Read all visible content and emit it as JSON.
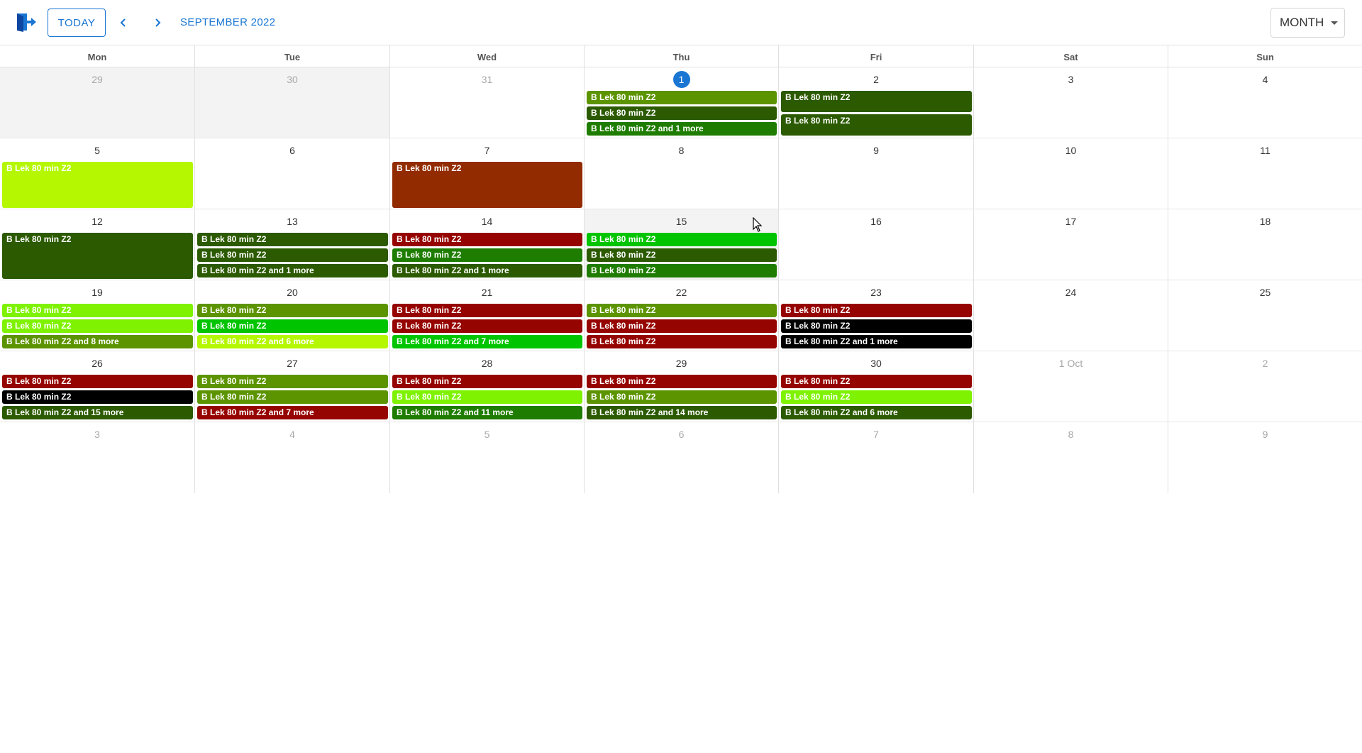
{
  "toolbar": {
    "exit_icon": "exit-to-app-icon",
    "today_label": "TODAY",
    "prev_icon": "chevron-left-icon",
    "next_icon": "chevron-right-icon",
    "month_title": "SEPTEMBER 2022",
    "view_label": "MONTH",
    "accent_color": "#1976d2"
  },
  "weekdays": [
    "Mon",
    "Tue",
    "Wed",
    "Thu",
    "Fri",
    "Sat",
    "Sun"
  ],
  "weeks": [
    [
      {
        "label": "29",
        "outside": true,
        "shaded": true,
        "events": []
      },
      {
        "label": "30",
        "outside": true,
        "shaded": true,
        "events": []
      },
      {
        "label": "31",
        "outside": true,
        "events": []
      },
      {
        "label": "1",
        "today": true,
        "events": [
          {
            "text": "B Lek 80 min Z2",
            "color": "#5c9400"
          },
          {
            "text": "B Lek 80 min Z2",
            "color": "#2b5a00"
          },
          {
            "text": "B Lek 80 min Z2 and 1 more",
            "color": "#1e7d00"
          }
        ]
      },
      {
        "label": "2",
        "events": [
          {
            "text": "B Lek 80 min Z2",
            "color": "#2b5a00",
            "size": "tall"
          },
          {
            "text": "B Lek 80 min Z2",
            "color": "#2b5a00",
            "size": "tall"
          }
        ]
      },
      {
        "label": "3",
        "events": []
      },
      {
        "label": "4",
        "events": []
      }
    ],
    [
      {
        "label": "5",
        "events": [
          {
            "text": "B Lek 80 min Z2",
            "color": "#b4f700",
            "size": "big"
          }
        ]
      },
      {
        "label": "6",
        "events": []
      },
      {
        "label": "7",
        "events": [
          {
            "text": "B Lek 80 min Z2",
            "color": "#922b00",
            "size": "big"
          }
        ]
      },
      {
        "label": "8",
        "events": []
      },
      {
        "label": "9",
        "events": []
      },
      {
        "label": "10",
        "events": []
      },
      {
        "label": "11",
        "events": []
      }
    ],
    [
      {
        "label": "12",
        "events": [
          {
            "text": "B Lek 80 min Z2",
            "color": "#2b5a00",
            "size": "big"
          }
        ]
      },
      {
        "label": "13",
        "events": [
          {
            "text": "B Lek 80 min Z2",
            "color": "#2b5a00"
          },
          {
            "text": "B Lek 80 min Z2",
            "color": "#2b5a00"
          },
          {
            "text": "B Lek 80 min Z2 and 1 more",
            "color": "#2b5a00"
          }
        ]
      },
      {
        "label": "14",
        "events": [
          {
            "text": "B Lek 80 min Z2",
            "color": "#950400"
          },
          {
            "text": "B Lek 80 min Z2",
            "color": "#1e7d00"
          },
          {
            "text": "B Lek 80 min Z2 and 1 more",
            "color": "#2b5a00"
          }
        ]
      },
      {
        "label": "15",
        "shaded": true,
        "events": [
          {
            "text": "B Lek 80 min Z2",
            "color": "#00c400"
          },
          {
            "text": "B Lek 80 min Z2",
            "color": "#2b5a00"
          },
          {
            "text": "B Lek 80 min Z2",
            "color": "#1e7d00"
          }
        ]
      },
      {
        "label": "16",
        "events": []
      },
      {
        "label": "17",
        "events": []
      },
      {
        "label": "18",
        "events": []
      }
    ],
    [
      {
        "label": "19",
        "events": [
          {
            "text": "B Lek 80 min Z2",
            "color": "#7ef200"
          },
          {
            "text": "B Lek 80 min Z2",
            "color": "#7ef200"
          },
          {
            "text": "B Lek 80 min Z2 and 8 more",
            "color": "#5c9400"
          }
        ]
      },
      {
        "label": "20",
        "events": [
          {
            "text": "B Lek 80 min Z2",
            "color": "#5c9400"
          },
          {
            "text": "B Lek 80 min Z2",
            "color": "#00c400"
          },
          {
            "text": "B Lek 80 min Z2 and 6 more",
            "color": "#b4f700"
          }
        ]
      },
      {
        "label": "21",
        "events": [
          {
            "text": "B Lek 80 min Z2",
            "color": "#950400"
          },
          {
            "text": "B Lek 80 min Z2",
            "color": "#950400"
          },
          {
            "text": "B Lek 80 min Z2 and 7 more",
            "color": "#00c400"
          }
        ]
      },
      {
        "label": "22",
        "events": [
          {
            "text": "B Lek 80 min Z2",
            "color": "#5c9400"
          },
          {
            "text": "B Lek 80 min Z2",
            "color": "#950400"
          },
          {
            "text": "B Lek 80 min Z2",
            "color": "#950400"
          }
        ]
      },
      {
        "label": "23",
        "events": [
          {
            "text": "B Lek 80 min Z2",
            "color": "#950400"
          },
          {
            "text": "B Lek 80 min Z2",
            "color": "#000000"
          },
          {
            "text": "B Lek 80 min Z2 and 1 more",
            "color": "#000000"
          }
        ]
      },
      {
        "label": "24",
        "events": []
      },
      {
        "label": "25",
        "events": []
      }
    ],
    [
      {
        "label": "26",
        "events": [
          {
            "text": "B Lek 80 min Z2",
            "color": "#950400"
          },
          {
            "text": "B Lek 80 min Z2",
            "color": "#000000"
          },
          {
            "text": "B Lek 80 min Z2 and 15 more",
            "color": "#2b5a00"
          }
        ]
      },
      {
        "label": "27",
        "events": [
          {
            "text": "B Lek 80 min Z2",
            "color": "#5c9400"
          },
          {
            "text": "B Lek 80 min Z2",
            "color": "#5c9400"
          },
          {
            "text": "B Lek 80 min Z2 and 7 more",
            "color": "#950400"
          }
        ]
      },
      {
        "label": "28",
        "events": [
          {
            "text": "B Lek 80 min Z2",
            "color": "#950400"
          },
          {
            "text": "B Lek 80 min Z2",
            "color": "#7ef200"
          },
          {
            "text": "B Lek 80 min Z2 and 11 more",
            "color": "#1e7d00"
          }
        ]
      },
      {
        "label": "29",
        "events": [
          {
            "text": "B Lek 80 min Z2",
            "color": "#950400"
          },
          {
            "text": "B Lek 80 min Z2",
            "color": "#5c9400"
          },
          {
            "text": "B Lek 80 min Z2 and 14 more",
            "color": "#2b5a00"
          }
        ]
      },
      {
        "label": "30",
        "events": [
          {
            "text": "B Lek 80 min Z2",
            "color": "#950400"
          },
          {
            "text": "B Lek 80 min Z2",
            "color": "#7ef200"
          },
          {
            "text": "B Lek 80 min Z2 and 6 more",
            "color": "#2b5a00"
          }
        ]
      },
      {
        "label": "1 Oct",
        "outside": true,
        "events": []
      },
      {
        "label": "2",
        "outside": true,
        "events": []
      }
    ],
    [
      {
        "label": "3",
        "outside": true,
        "events": []
      },
      {
        "label": "4",
        "outside": true,
        "events": []
      },
      {
        "label": "5",
        "outside": true,
        "events": []
      },
      {
        "label": "6",
        "outside": true,
        "events": []
      },
      {
        "label": "7",
        "outside": true,
        "events": []
      },
      {
        "label": "8",
        "outside": true,
        "events": []
      },
      {
        "label": "9",
        "outside": true,
        "events": []
      }
    ]
  ]
}
